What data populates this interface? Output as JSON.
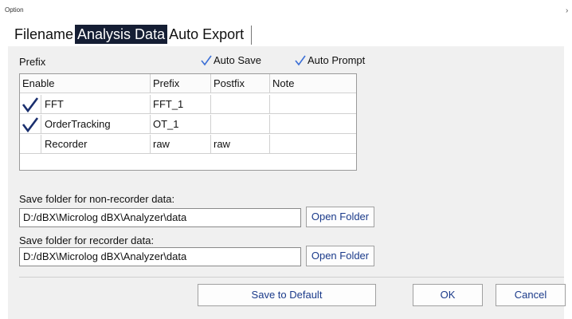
{
  "window": {
    "title": "Option",
    "close_glyph": "›"
  },
  "tabs": [
    {
      "label": "Filename",
      "active": false
    },
    {
      "label": "Analysis Data",
      "active": true
    },
    {
      "label": "Auto Export",
      "active": false
    }
  ],
  "prefix_section": {
    "label": "Prefix",
    "auto_save": {
      "label": "Auto Save",
      "checked": true
    },
    "auto_prompt": {
      "label": "Auto Prompt",
      "checked": true
    }
  },
  "table": {
    "headers": [
      "Enable",
      "Prefix",
      "Postfix",
      "Note"
    ],
    "rows": [
      {
        "enable": true,
        "name": "FFT",
        "prefix": "FFT_1",
        "postfix": "",
        "note": ""
      },
      {
        "enable": true,
        "name": "OrderTracking",
        "prefix": "OT_1",
        "postfix": "",
        "note": ""
      },
      {
        "enable": false,
        "name": "Recorder",
        "prefix": "raw",
        "postfix": "raw",
        "note": ""
      }
    ]
  },
  "non_recorder": {
    "label": "Save folder for non-recorder data:",
    "path": "D:/dBX\\Microlog dBX\\Analyzer\\data",
    "button": "Open Folder"
  },
  "recorder": {
    "label": "Save folder for recorder data:",
    "path": "D:/dBX\\Microlog dBX\\Analyzer\\data",
    "button": "Open Folder"
  },
  "footer": {
    "save_default": "Save to Default",
    "ok": "OK",
    "cancel": "Cancel"
  },
  "colors": {
    "active_tab": "#151e34",
    "check": "#1a2f6e",
    "panel": "#f0f0f0"
  }
}
